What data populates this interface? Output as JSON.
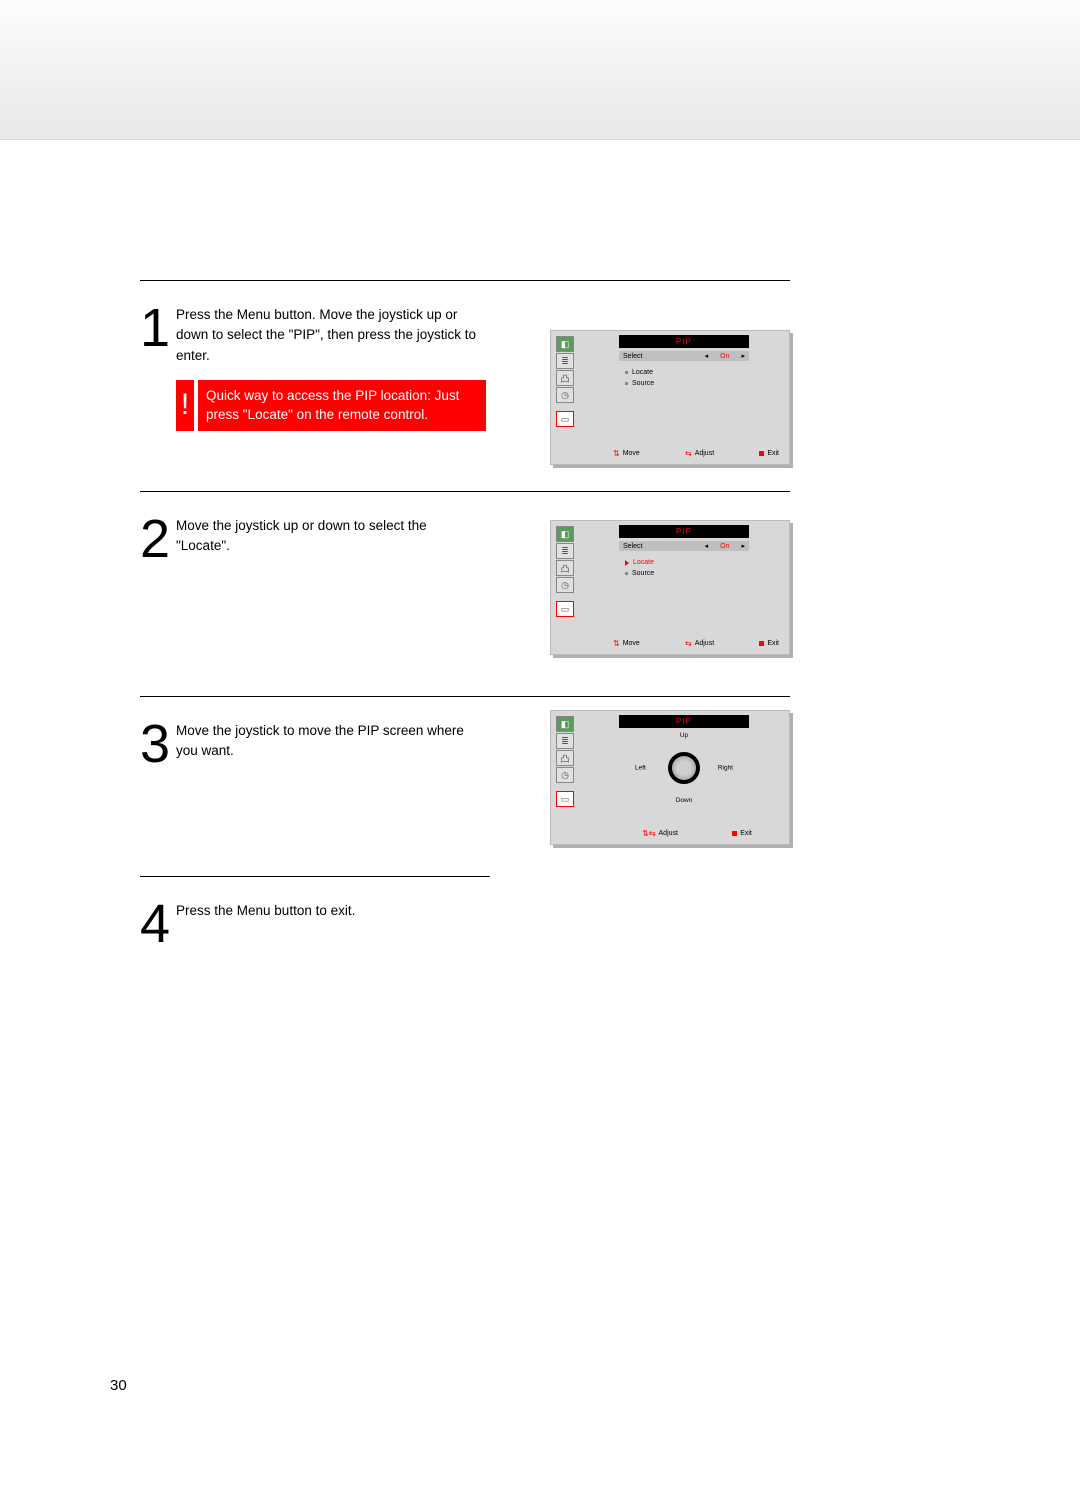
{
  "page_number": "30",
  "steps": [
    {
      "num": "1",
      "text": "Press the Menu button. Move the joystick up or down to select the \"PIP\", then press the joystick to enter."
    },
    {
      "num": "2",
      "text": "Move the joystick up or down to select the \"Locate\"."
    },
    {
      "num": "3",
      "text": "Move the joystick to move the PIP screen where you want."
    },
    {
      "num": "4",
      "text": "Press the Menu button to exit."
    }
  ],
  "alert": {
    "mark": "!",
    "text": "Quick way to access the PIP location: Just press \"Locate\" on the remote control."
  },
  "osd": {
    "title": "PIP",
    "select_label": "Select",
    "select_value": "On",
    "items": {
      "locate": "Locate",
      "source": "Source"
    },
    "footer": {
      "move": "Move",
      "adjust": "Adjust",
      "exit": "Exit"
    },
    "joystick": {
      "up": "Up",
      "down": "Down",
      "left": "Left",
      "right": "Right"
    }
  }
}
